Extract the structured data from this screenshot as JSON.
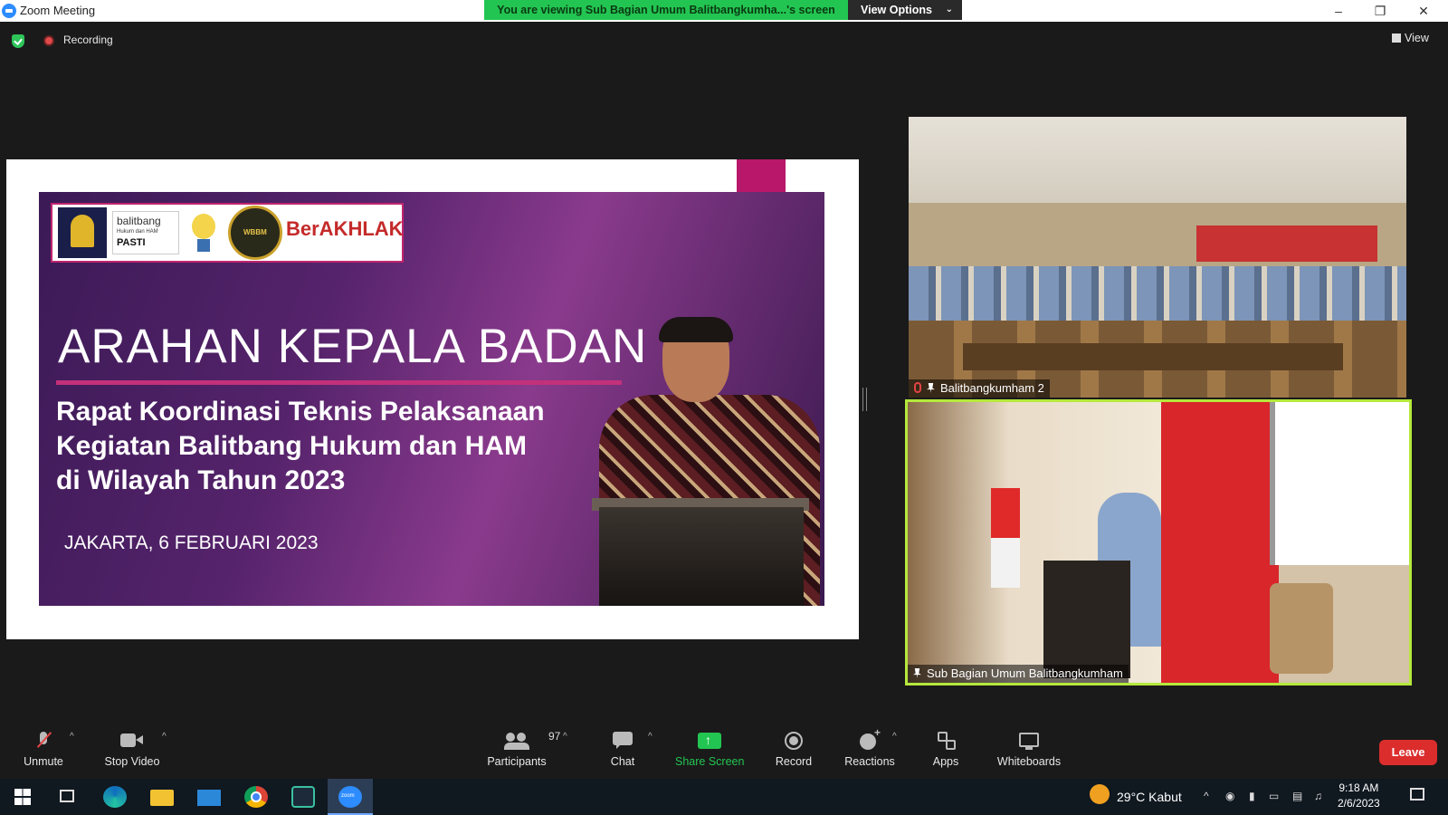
{
  "window": {
    "title": "Zoom Meeting",
    "viewing_banner": "You are viewing Sub Bagian Umum Balitbangkumha...'s screen",
    "view_options": "View Options",
    "minimize": "–",
    "restore": "❐",
    "close": "✕"
  },
  "status": {
    "recording_label": "Recording",
    "view_label": "View"
  },
  "slide": {
    "title": "ARAHAN KEPALA BADAN",
    "subtitle_lines": [
      "Rapat Koordinasi Teknis Pelaksanaan",
      "Kegiatan Balitbang Hukum dan HAM",
      "di Wilayah Tahun 2023"
    ],
    "date": "JAKARTA, 6 FEBRUARI 2023",
    "logos": {
      "balitbang": "balitbang",
      "balitbang_sub": "Hukum dan HAM",
      "pasti": "PASTI",
      "berakhlak": "BerAKHLAK"
    }
  },
  "participants_video": [
    {
      "name": "Balitbangkumham 2"
    },
    {
      "name": "Sub Bagian Umum Balitbangkumham"
    }
  ],
  "toolbar": {
    "unmute": "Unmute",
    "stop_video": "Stop Video",
    "participants": "Participants",
    "participants_count": "97",
    "chat": "Chat",
    "share_screen": "Share Screen",
    "record": "Record",
    "reactions": "Reactions",
    "apps": "Apps",
    "whiteboards": "Whiteboards",
    "leave": "Leave"
  },
  "taskbar": {
    "weather_temp": "29°C",
    "weather_desc": "Kabut",
    "time": "9:18 AM",
    "date": "2/6/2023"
  },
  "colors": {
    "share_green": "#23c552",
    "leave_red": "#dc2d2d",
    "active_speaker_border": "#b5e83c",
    "slide_accent": "#b8176a"
  }
}
